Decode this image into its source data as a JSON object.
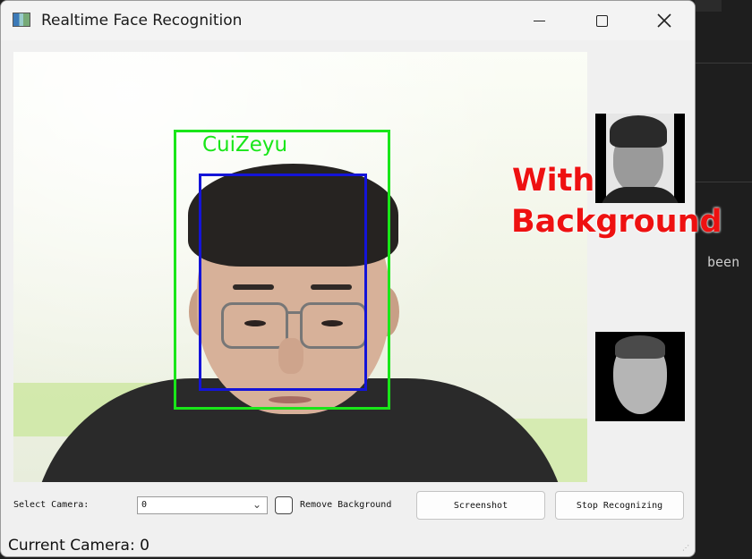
{
  "window": {
    "title": "Realtime Face Recognition"
  },
  "video": {
    "detected_name": "CuiZeyu",
    "annotation_line1": "With",
    "annotation_line2": "Background"
  },
  "controls": {
    "select_camera_label": "Select Camera:",
    "camera_value": "0",
    "remove_background_label": "Remove Background",
    "remove_background_checked": false,
    "screenshot_label": "Screenshot",
    "stop_label": "Stop Recognizing"
  },
  "status": {
    "current_camera": "Current Camera: 0"
  },
  "background_editor": {
    "visible_text": "been"
  },
  "colors": {
    "detection_box": "#19e619",
    "face_box": "#1414d8",
    "annotation": "#ee1111"
  }
}
